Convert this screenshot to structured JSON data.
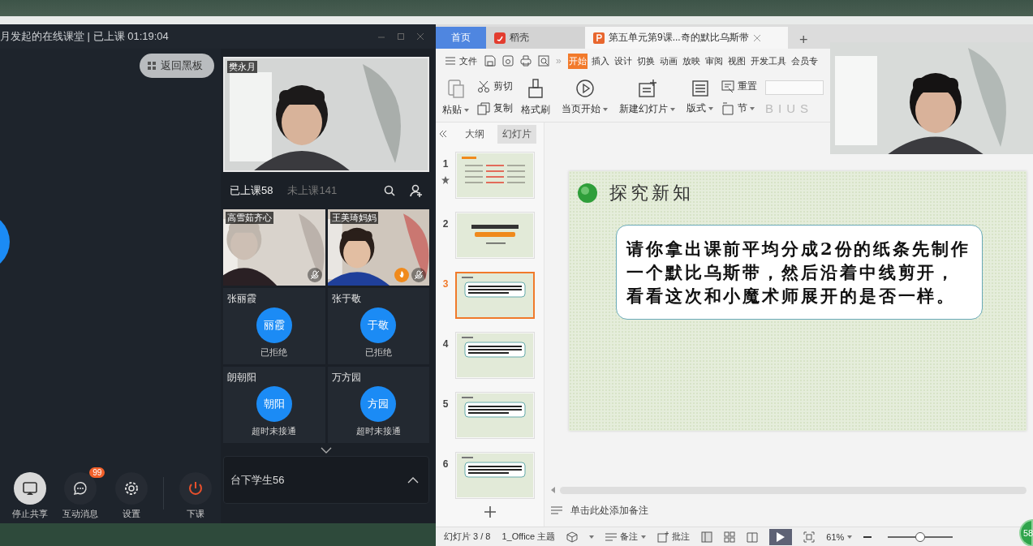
{
  "classroom": {
    "title": "月发起的在线课堂 | 已上课 01:19:04",
    "return_button": "返回黑板",
    "teacher": {
      "name": "樊永月"
    },
    "tabs": [
      {
        "label": "已上课58",
        "selected": true
      },
      {
        "label": "未上课141",
        "selected": false
      }
    ],
    "students": [
      {
        "kind": "video",
        "name": "高雪茹齐心",
        "reward": false
      },
      {
        "kind": "video",
        "name": "王美琦妈妈",
        "reward": true
      },
      {
        "kind": "avatar",
        "name": "张丽霞",
        "avatar": "丽霞",
        "status": "已拒绝"
      },
      {
        "kind": "avatar",
        "name": "张于敬",
        "avatar": "于敬",
        "status": "已拒绝"
      },
      {
        "kind": "avatar",
        "name": "朗朝阳",
        "avatar": "朝阳",
        "status": "超时未接通"
      },
      {
        "kind": "avatar",
        "name": "万方园",
        "avatar": "方园",
        "status": "超时未接通"
      }
    ],
    "audience": "台下学生56",
    "toolbar": [
      {
        "kind": "share",
        "label": "停止共享"
      },
      {
        "kind": "chat",
        "label": "互动消息",
        "badge": "99"
      },
      {
        "kind": "settings",
        "label": "设置"
      },
      {
        "kind": "power",
        "label": "下课"
      }
    ]
  },
  "wps": {
    "tabs": [
      {
        "kind": "home",
        "label": "首页",
        "selected": false
      },
      {
        "kind": "docer",
        "label": "稻壳",
        "selected": false
      },
      {
        "kind": "document",
        "label": "第五单元第9课...奇的默比乌斯带",
        "selected": true
      }
    ],
    "new_tab": "+",
    "file_menu": "文件",
    "more": "»",
    "ribbon_tabs": [
      {
        "label": "开始",
        "selected": true
      },
      {
        "label": "插入",
        "selected": false
      },
      {
        "label": "设计",
        "selected": false
      },
      {
        "label": "切换",
        "selected": false
      },
      {
        "label": "动画",
        "selected": false
      },
      {
        "label": "放映",
        "selected": false
      },
      {
        "label": "审阅",
        "selected": false
      },
      {
        "label": "视图",
        "selected": false
      },
      {
        "label": "开发工具",
        "selected": false
      },
      {
        "label": "会员专",
        "selected": false
      }
    ],
    "tools": [
      {
        "kind": "paste",
        "label": "粘贴",
        "dropdown": true
      },
      {
        "kind": "cut",
        "label": "剪切",
        "dropdown": false
      },
      {
        "kind": "copy",
        "label": "复制",
        "dropdown": false
      },
      {
        "kind": "brush",
        "label": "格式刷",
        "dropdown": false
      },
      {
        "kind": "play",
        "label": "当页开始",
        "dropdown": true
      },
      {
        "kind": "new-slide",
        "label": "新建幻灯片",
        "dropdown": true
      },
      {
        "kind": "layout",
        "label": "版式",
        "dropdown": true
      },
      {
        "kind": "reset",
        "label": "重置",
        "dropdown": false
      },
      {
        "kind": "section",
        "label": "节",
        "dropdown": true
      }
    ],
    "format_buttons": [
      "B",
      "I",
      "U",
      "S"
    ],
    "panel_tabs": [
      {
        "label": "大纲",
        "selected": false
      },
      {
        "label": "幻灯片",
        "selected": true
      }
    ],
    "slides": [
      {
        "number": "1",
        "kind": "table",
        "starred": true,
        "selected": false
      },
      {
        "number": "2",
        "kind": "title",
        "starred": false,
        "selected": false
      },
      {
        "number": "3",
        "kind": "text",
        "starred": false,
        "selected": true
      },
      {
        "number": "4",
        "kind": "text",
        "starred": false,
        "selected": false
      },
      {
        "number": "5",
        "kind": "text",
        "starred": false,
        "selected": false
      },
      {
        "number": "6",
        "kind": "text",
        "starred": false,
        "selected": false
      }
    ],
    "slide": {
      "heading": "探究新知",
      "body": "请你拿出课前平均分成2份的纸条先制作一个默比乌斯带，然后沿着中线剪开，看看这次和小魔术师展开的是否一样。"
    },
    "notes_placeholder": "单击此处添加备注",
    "status": {
      "slide_counter": "幻灯片 3 / 8",
      "theme": "1_Office 主题",
      "notes": "备注",
      "comments": "批注",
      "zoom": "61%",
      "zoom_slider": {
        "level": 0.5
      }
    }
  },
  "overlay": {
    "camera_badge": "58"
  }
}
